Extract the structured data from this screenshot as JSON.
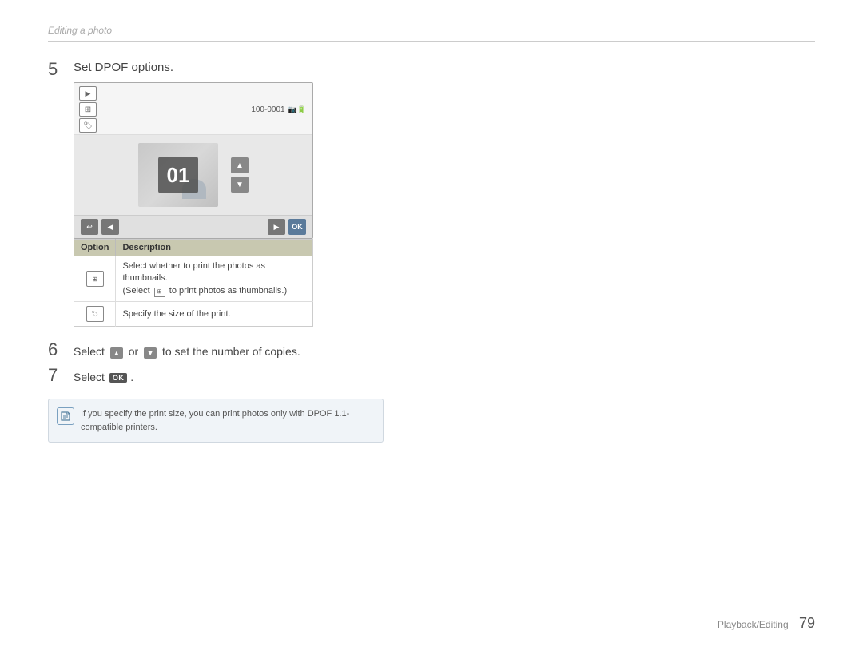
{
  "breadcrumb": {
    "text": "Editing a photo"
  },
  "step5": {
    "number": "5",
    "title": "Set DPOF options.",
    "camera": {
      "topbar_text": "100-0001",
      "number_display": "01"
    },
    "table": {
      "col1": "Option",
      "col2": "Description",
      "rows": [
        {
          "description": "Select whether to print the photos as thumbnails. (Select  to print photos as thumbnails.)"
        },
        {
          "description": "Specify the size of the print."
        }
      ]
    }
  },
  "step6": {
    "number": "6",
    "text_before": "Select",
    "up_arrow": "▲",
    "text_middle": "or",
    "down_arrow": "▼",
    "text_after": "to set the number of copies."
  },
  "step7": {
    "number": "7",
    "text": "Select",
    "ok_label": "OK"
  },
  "note": {
    "icon": "✎",
    "text": "If you specify the print size, you can print photos only with DPOF 1.1-compatible printers."
  },
  "footer": {
    "text": "Playback/Editing",
    "page_number": "79"
  }
}
